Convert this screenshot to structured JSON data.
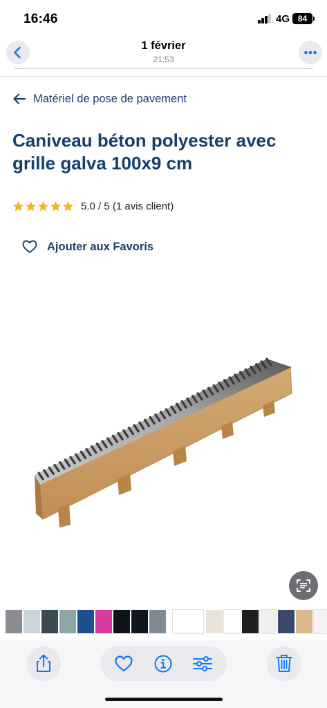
{
  "status_bar": {
    "time": "16:46",
    "network": "4G",
    "battery": "84"
  },
  "photo_header": {
    "title": "1 février",
    "subtitle": "21:53",
    "back_icon": "chevron-left-icon",
    "more_icon": "ellipsis-icon"
  },
  "page": {
    "breadcrumb": "Matériel de pose de pavement",
    "title": "Caniveau béton polyester avec grille galva 100x9 cm",
    "rating": {
      "stars": 5,
      "text": "5.0 / 5 (1 avis client)"
    },
    "favorites_label": "Ajouter aux Favoris"
  },
  "colors": {
    "title": "#14406f",
    "star": "#f3b51b",
    "ios_blue": "#0a7aff",
    "toolbar_bg": "#f6f6f8"
  },
  "toolbar": {
    "share_icon": "share-icon",
    "favorite_icon": "heart-icon",
    "info_icon": "info-icon",
    "adjust_icon": "sliders-icon",
    "delete_icon": "trash-icon"
  }
}
